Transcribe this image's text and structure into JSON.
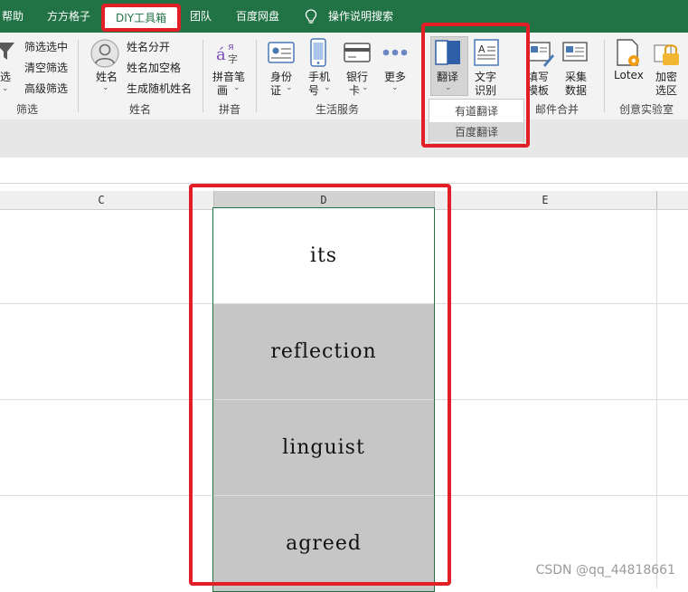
{
  "tabs": [
    {
      "label": "帮助"
    },
    {
      "label": "方方格子"
    },
    {
      "label": "DIY工具箱"
    },
    {
      "label": "团队"
    },
    {
      "label": "百度网盘"
    },
    {
      "label": "操作说明搜索"
    }
  ],
  "ribbon": {
    "filter_group": {
      "cut_label_top": "选",
      "cut_label_bottom": "筛选",
      "items": [
        "筛选选中",
        "清空筛选",
        "高级筛选"
      ],
      "label": "筛选"
    },
    "name_group": {
      "big_button": "姓名",
      "items": [
        "姓名分开",
        "姓名加空格",
        "生成随机姓名"
      ],
      "label": "姓名"
    },
    "pinyin_group": {
      "button_line1": "拼音笔",
      "button_line2": "画",
      "label": "拼音"
    },
    "life_group": {
      "buttons": [
        {
          "line1": "身份",
          "line2": "证"
        },
        {
          "line1": "手机",
          "line2": "号"
        },
        {
          "line1": "银行",
          "line2": "卡"
        },
        {
          "line1": "更多",
          "line2": ""
        }
      ],
      "label": "生活服务"
    },
    "translate_group": {
      "translate_button": "翻译",
      "ocr_line1": "文字",
      "ocr_line2": "识别"
    },
    "mail_group": {
      "fill_line1": "填写",
      "fill_line2": "模板",
      "collect_line1": "采集",
      "collect_line2": "数据",
      "label": "邮件合并"
    },
    "lab_group": {
      "lotex": "Lotex",
      "encrypt_line1": "加密",
      "encrypt_line2": "选区",
      "label": "创意实验室"
    }
  },
  "dropdown": {
    "items": [
      "有道翻译",
      "百度翻译"
    ]
  },
  "columns": [
    "C",
    "D",
    "E"
  ],
  "cells": [
    "its",
    "reflection",
    "linguist",
    "agreed"
  ],
  "watermark": "CSDN @qq_44818661",
  "colors": {
    "excel_green": "#217346",
    "highlight_red": "#e21f26",
    "selected_gray": "#c6c6c6"
  }
}
